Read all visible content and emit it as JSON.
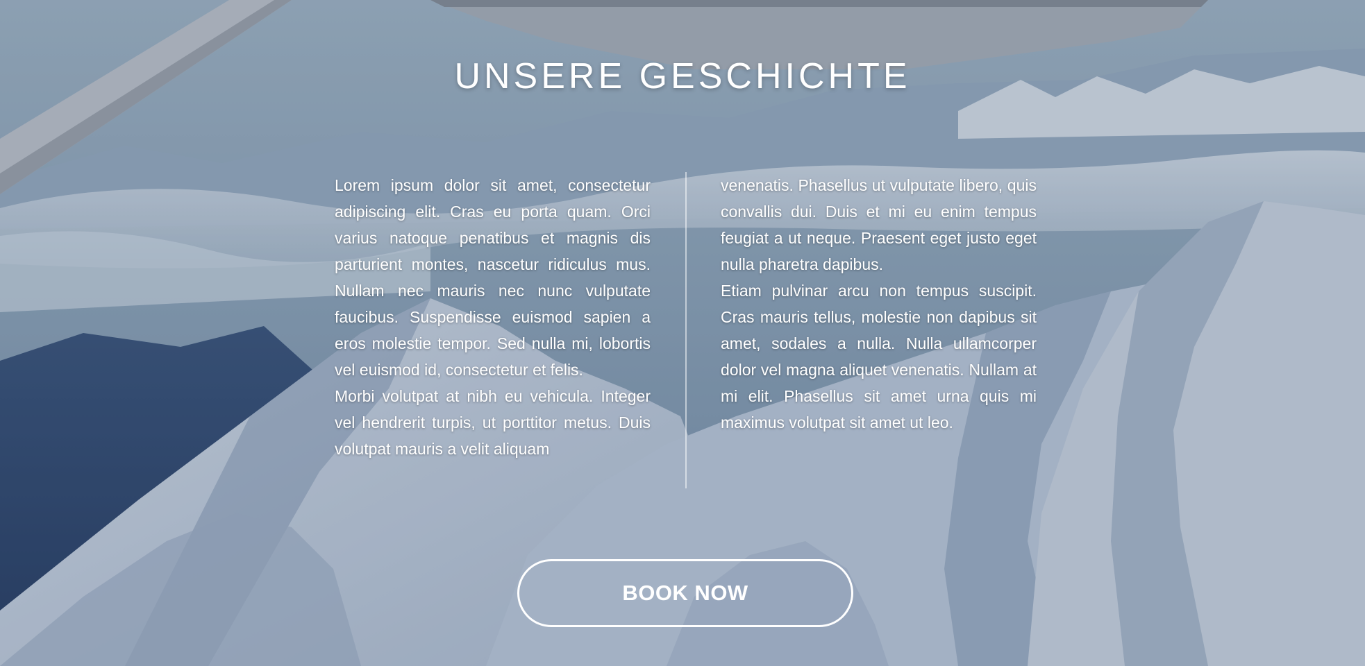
{
  "section": {
    "title": "UNSERE GESCHICHTE"
  },
  "story": {
    "left_paragraphs": [
      "Lorem ipsum dolor sit amet, consectetur adipiscing elit. Cras eu porta quam. Orci varius natoque penatibus et magnis dis parturient montes, nascetur ridiculus mus. Nullam nec mauris nec nunc vulputate faucibus. Suspendisse euismod sapien a eros molestie tempor. Sed nulla mi, lobortis vel euismod id, consectetur et felis.",
      "Morbi volutpat at nibh eu vehicula. Integer vel hendrerit turpis, ut porttitor metus. Duis volutpat mauris a velit aliquam"
    ],
    "right_paragraphs": [
      "venenatis. Phasellus ut vulputate libero, quis convallis dui. Duis et mi eu enim tempus feugiat a ut neque. Praesent eget justo eget nulla pharetra dapibus.",
      "Etiam pulvinar arcu non tempus suscipit. Cras mauris tellus, molestie non dapibus sit amet, sodales a nulla. Nulla ullamcorper dolor vel magna aliquet venenatis. Nullam at mi elit. Phasellus sit amet urna quis mi maximus volutpat sit amet ut leo."
    ]
  },
  "cta": {
    "book_label": "BOOK NOW"
  },
  "colors": {
    "text": "#ffffff",
    "button_border": "#ffffff"
  }
}
